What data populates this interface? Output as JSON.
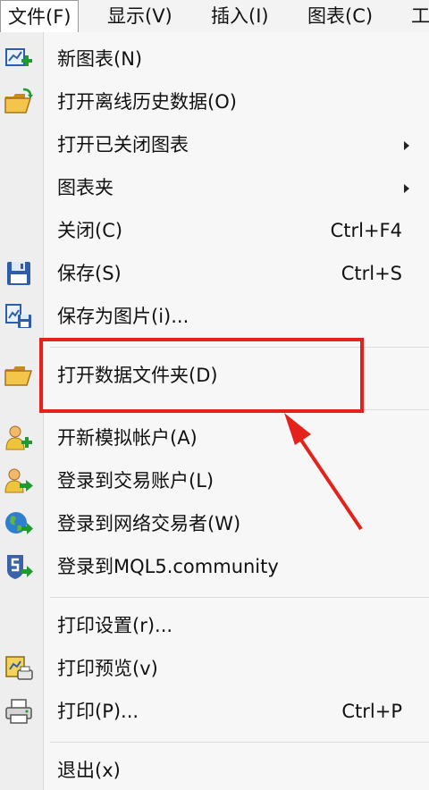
{
  "menubar": {
    "items": [
      "文件(F)",
      "显示(V)",
      "插入(I)",
      "图表(C)",
      "工"
    ]
  },
  "menu": {
    "items": [
      {
        "label": "新图表(N)",
        "shortcut": "",
        "icon": "new-chart-icon"
      },
      {
        "label": "打开离线历史数据(O)",
        "shortcut": "",
        "icon": "open-folder-icon"
      },
      {
        "label": "打开已关闭图表",
        "shortcut": "",
        "icon": ""
      },
      {
        "label": "图表夹",
        "shortcut": "",
        "icon": ""
      },
      {
        "label": "关闭(C)",
        "shortcut": "Ctrl+F4",
        "icon": ""
      },
      {
        "label": "保存(S)",
        "shortcut": "Ctrl+S",
        "icon": "save-icon"
      },
      {
        "label": "保存为图片(i)...",
        "shortcut": "",
        "icon": "save-as-picture-icon"
      },
      {
        "label": "打开数据文件夹(D)",
        "shortcut": "",
        "icon": "folder-icon"
      },
      {
        "label": "开新模拟帐户(A)",
        "shortcut": "",
        "icon": "new-account-icon"
      },
      {
        "label": "登录到交易账户(L)",
        "shortcut": "",
        "icon": "login-account-icon"
      },
      {
        "label": "登录到网络交易者(W)",
        "shortcut": "",
        "icon": "web-trader-icon"
      },
      {
        "label": "登录到MQL5.community",
        "shortcut": "",
        "icon": "mql5-icon"
      },
      {
        "label": "打印设置(r)...",
        "shortcut": "",
        "icon": ""
      },
      {
        "label": "打印预览(v)",
        "shortcut": "",
        "icon": "print-preview-icon"
      },
      {
        "label": "打印(P)...",
        "shortcut": "Ctrl+P",
        "icon": "printer-icon"
      },
      {
        "label": "退出(x)",
        "shortcut": "",
        "icon": ""
      }
    ]
  },
  "annotation": {
    "color": "#e3231b"
  }
}
